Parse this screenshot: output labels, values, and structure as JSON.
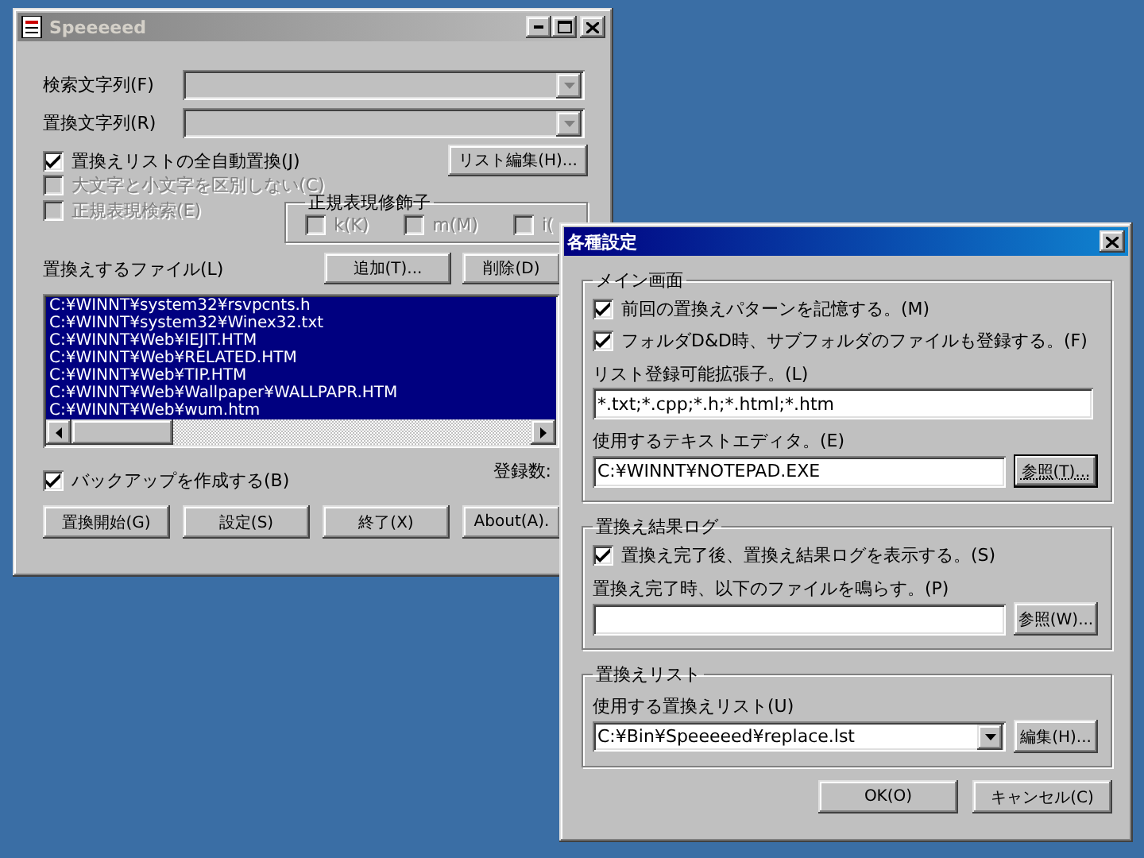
{
  "main_window": {
    "title": "Speeeeed",
    "active": false,
    "search_label": "検索文字列(F)",
    "replace_label": "置換文字列(R)",
    "options": [
      {
        "label": "置換えリストの全自動置換(J)",
        "checked": true,
        "disabled": false
      },
      {
        "label": "大文字と小文字を区別しない(C)",
        "checked": false,
        "disabled": true
      },
      {
        "label": "正規表現検索(E)",
        "checked": false,
        "disabled": true
      }
    ],
    "list_edit_button": "リスト編集(H)...",
    "modifiers": {
      "title": "正規表現修飾子",
      "items": [
        {
          "label": "k(K)",
          "checked": false,
          "disabled": true
        },
        {
          "label": "m(M)",
          "checked": false,
          "disabled": true
        },
        {
          "label": "i(",
          "checked": false,
          "disabled": true
        }
      ]
    },
    "files_label": "置換えするファイル(L)",
    "add_button": "追加(T)...",
    "delete_button": "削除(D)",
    "files": [
      {
        "path": "C:¥WINNT¥system32¥rsvpcnts.h",
        "selected": true
      },
      {
        "path": "C:¥WINNT¥system32¥Winex32.txt",
        "selected": true
      },
      {
        "path": "C:¥WINNT¥Web¥IEJIT.HTM",
        "selected": true
      },
      {
        "path": "C:¥WINNT¥Web¥RELATED.HTM",
        "selected": true
      },
      {
        "path": "C:¥WINNT¥Web¥TIP.HTM",
        "selected": true
      },
      {
        "path": "C:¥WINNT¥Web¥Wallpaper¥WALLPAPR.HTM",
        "selected": true
      },
      {
        "path": "C:¥WINNT¥Web¥wum.htm",
        "selected": true
      }
    ],
    "backup": {
      "label": "バックアップを作成する(B)",
      "checked": true
    },
    "count_label": "登録数:",
    "buttons": [
      "置換開始(G)",
      "設定(S)",
      "終了(X)",
      "About(A)."
    ]
  },
  "dialog": {
    "title": "各種設定",
    "active": true,
    "groups": [
      {
        "title": "メイン画面",
        "items": [
          {
            "kind": "checkbox",
            "label": "前回の置換えパターンを記憶する。(M)",
            "checked": true
          },
          {
            "kind": "checkbox",
            "label": "フォルダD&D時、サブフォルダのファイルも登録する。(F)",
            "checked": true
          },
          {
            "kind": "text",
            "label": "リスト登録可能拡張子。(L)",
            "value": "*.txt;*.cpp;*.h;*.html;*.htm"
          },
          {
            "kind": "browse",
            "label": "使用するテキストエディタ。(E)",
            "value": "C:¥WINNT¥NOTEPAD.EXE",
            "button": "参照(T)...",
            "focused": true
          }
        ]
      },
      {
        "title": "置換え結果ログ",
        "items": [
          {
            "kind": "checkbox",
            "label": "置換え完了後、置換え結果ログを表示する。(S)",
            "checked": true
          },
          {
            "kind": "browse",
            "label": "置換え完了時、以下のファイルを鳴らす。(P)",
            "button": "参照(W)...",
            "focused": false
          }
        ]
      },
      {
        "title": "置換えリスト",
        "items": [
          {
            "kind": "combo",
            "label": "使用する置換えリスト(U)",
            "value": "C:¥Bin¥Speeeeed¥replace.lst",
            "button": "編集(H)..."
          }
        ]
      }
    ],
    "buttons": [
      "OK(O)",
      "キャンセル(C)"
    ]
  }
}
